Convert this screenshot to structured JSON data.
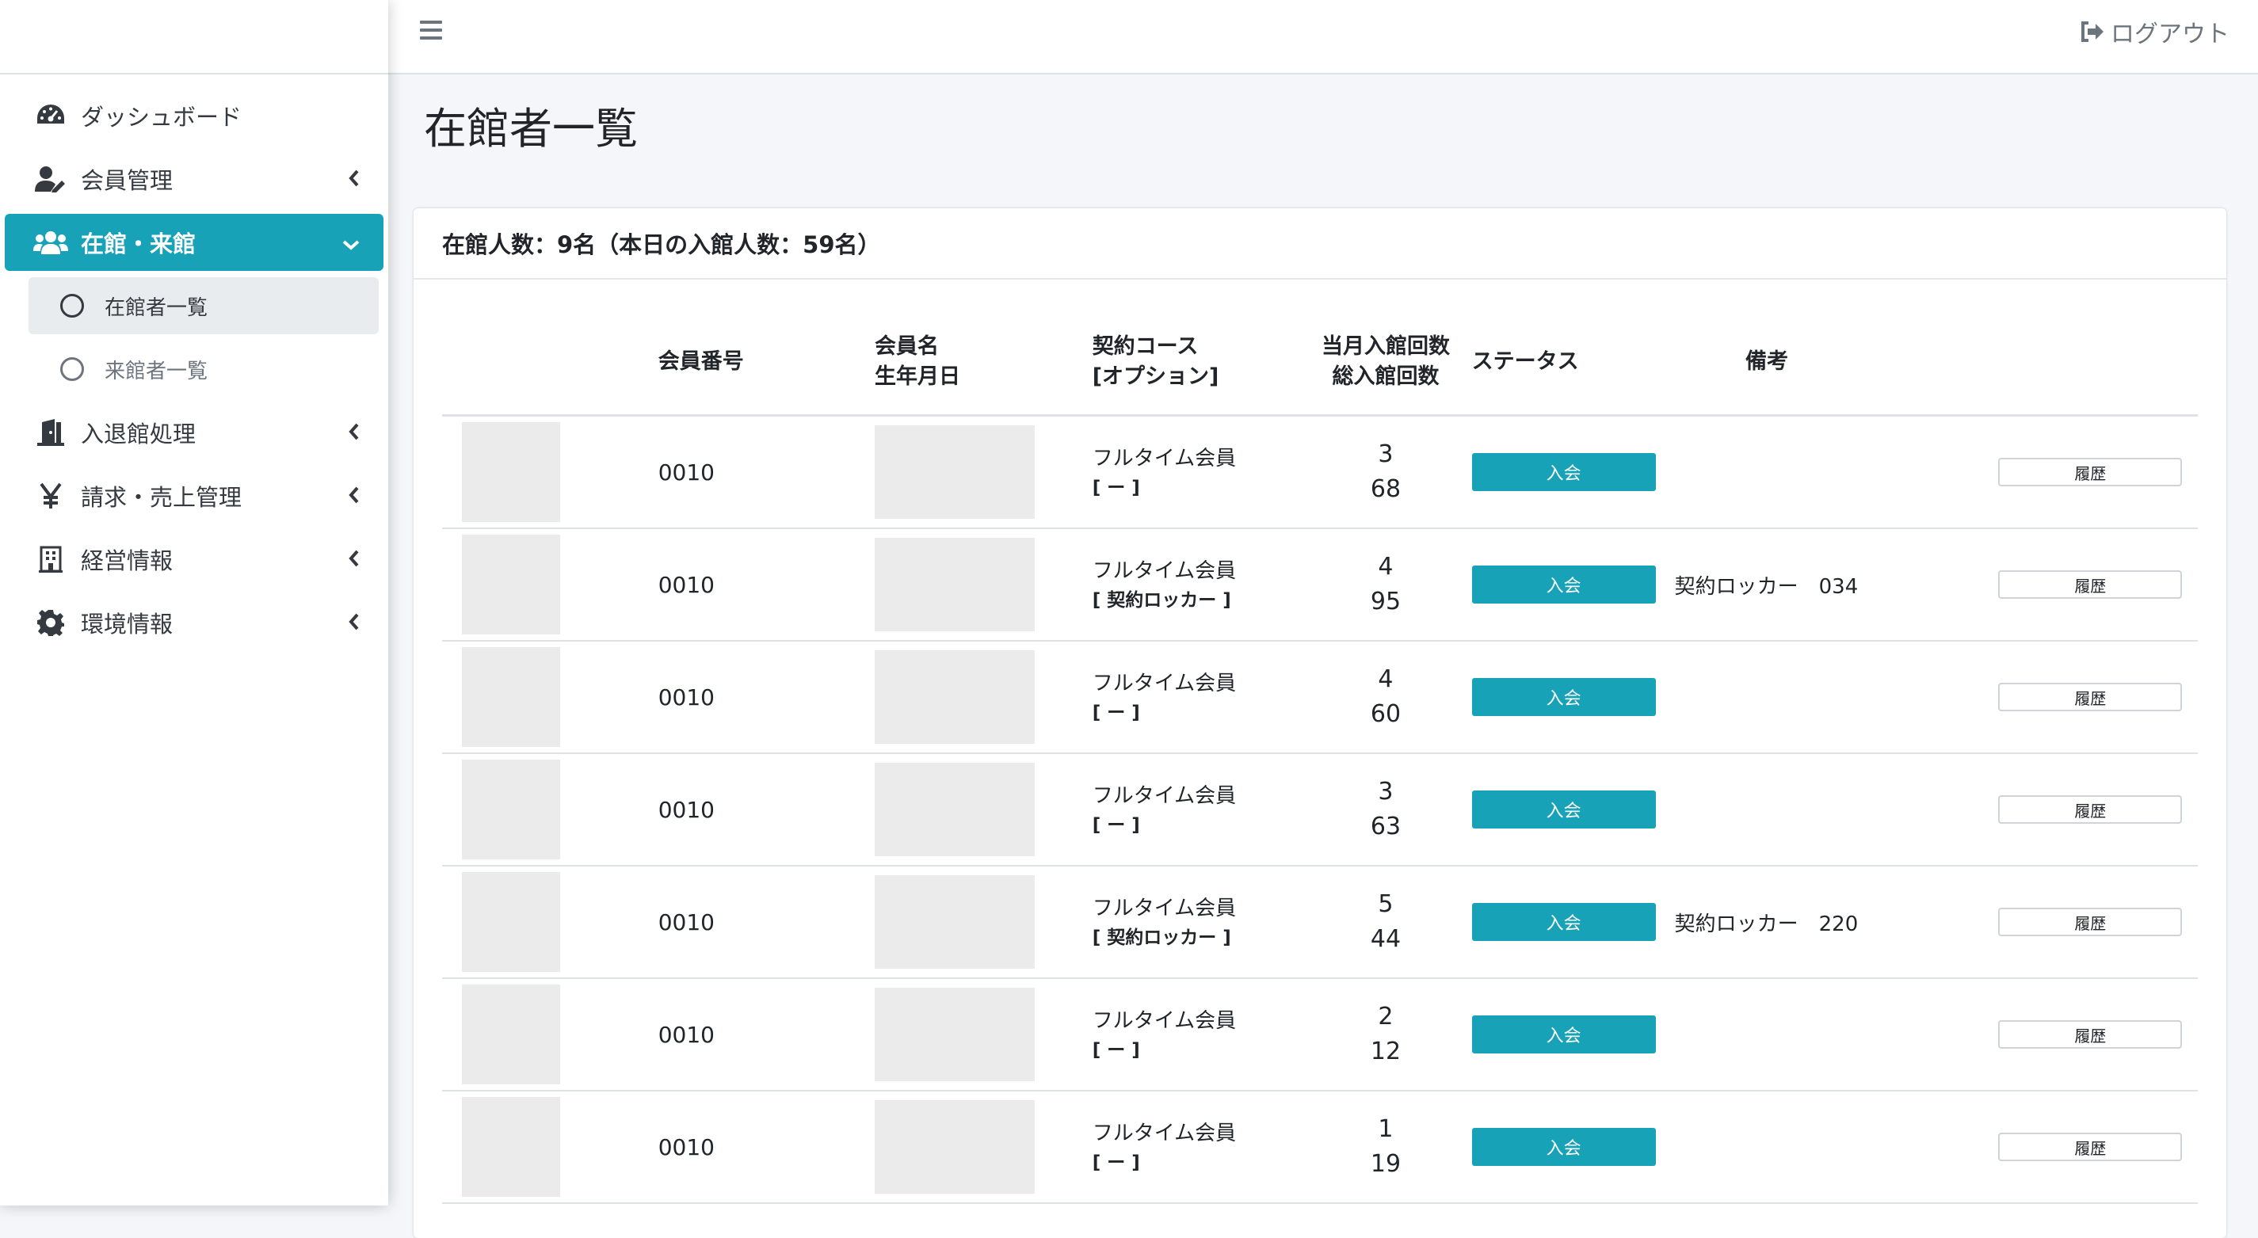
{
  "sidebar": {
    "items": [
      {
        "label": "ダッシュボード",
        "icon": "tachometer-icon"
      },
      {
        "label": "会員管理",
        "icon": "user-edit-icon"
      },
      {
        "label": "在館・来館",
        "icon": "users-icon"
      },
      {
        "label": "入退館処理",
        "icon": "door-icon"
      },
      {
        "label": "請求・売上管理",
        "icon": "yen-icon"
      },
      {
        "label": "経営情報",
        "icon": "building-icon"
      },
      {
        "label": "環境情報",
        "icon": "gear-icon"
      }
    ],
    "subitems": [
      {
        "label": "在館者一覧"
      },
      {
        "label": "来館者一覧"
      }
    ]
  },
  "header": {
    "logout_label": "ログアウト"
  },
  "page": {
    "title": "在館者一覧"
  },
  "card": {
    "summary": "在館人数：9名（本日の入館人数：59名）"
  },
  "table": {
    "headers": {
      "member_no": "会員番号",
      "name": "会員名",
      "birth": "生年月日",
      "course": "契約コース",
      "option": "[オプション]",
      "month_visits": "当月入館回数",
      "total_visits": "総入館回数",
      "status": "ステータス",
      "note": "備考"
    },
    "rows": [
      {
        "member_no": "0010",
        "course": "フルタイム会員",
        "option": "[ ー ]",
        "month": "3",
        "total": "68",
        "status": "入会",
        "note": "",
        "note_num": "",
        "history": "履歴"
      },
      {
        "member_no": "0010",
        "course": "フルタイム会員",
        "option": "[ 契約ロッカー ]",
        "month": "4",
        "total": "95",
        "status": "入会",
        "note": "契約ロッカー",
        "note_num": "034",
        "history": "履歴"
      },
      {
        "member_no": "0010",
        "course": "フルタイム会員",
        "option": "[ ー ]",
        "month": "4",
        "total": "60",
        "status": "入会",
        "note": "",
        "note_num": "",
        "history": "履歴"
      },
      {
        "member_no": "0010",
        "course": "フルタイム会員",
        "option": "[ ー ]",
        "month": "3",
        "total": "63",
        "status": "入会",
        "note": "",
        "note_num": "",
        "history": "履歴"
      },
      {
        "member_no": "0010",
        "course": "フルタイム会員",
        "option": "[ 契約ロッカー ]",
        "month": "5",
        "total": "44",
        "status": "入会",
        "note": "契約ロッカー",
        "note_num": "220",
        "history": "履歴"
      },
      {
        "member_no": "0010",
        "course": "フルタイム会員",
        "option": "[ ー ]",
        "month": "2",
        "total": "12",
        "status": "入会",
        "note": "",
        "note_num": "",
        "history": "履歴"
      },
      {
        "member_no": "0010",
        "course": "フルタイム会員",
        "option": "[ ー ]",
        "month": "1",
        "total": "19",
        "status": "入会",
        "note": "",
        "note_num": "",
        "history": "履歴"
      }
    ]
  },
  "colors": {
    "accent": "#17a2b8",
    "placeholder": "#ebebeb",
    "background": "#f4f6f9"
  }
}
